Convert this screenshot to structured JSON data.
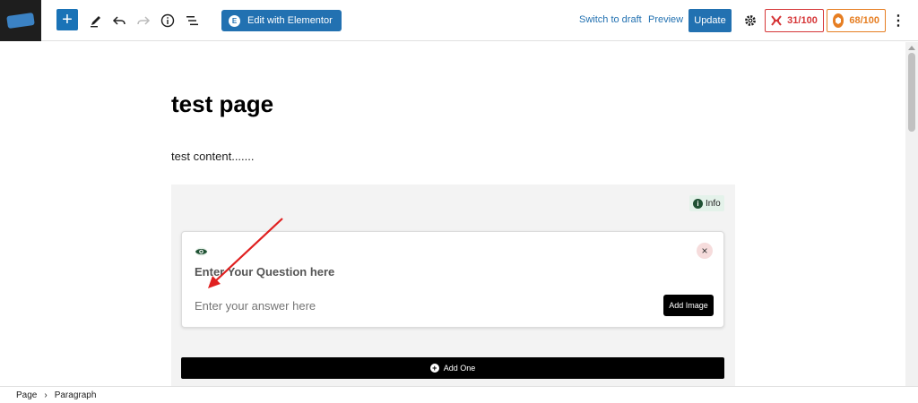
{
  "toolbar": {
    "add_label": "+",
    "elementor_label": "Edit with Elementor",
    "elementor_icon": "E",
    "switch_draft_label": "Switch to draft",
    "preview_label": "Preview",
    "update_label": "Update",
    "seo_score_red": "31/100",
    "seo_score_orange": "68/100",
    "more_icon": "⋮"
  },
  "editor": {
    "page_title": "test page",
    "paragraph": "test content......."
  },
  "faq_block": {
    "info_label": "Info",
    "question_placeholder": "Enter Your Question here",
    "answer_placeholder": "Enter your answer here",
    "add_image_label": "Add Image",
    "add_one_label": "Add One",
    "close_icon": "×"
  },
  "footer": {
    "breadcrumb": [
      "Page",
      "Paragraph"
    ]
  },
  "colors": {
    "accent": "#2271b1",
    "danger": "#d63638",
    "warning": "#e67e22"
  }
}
